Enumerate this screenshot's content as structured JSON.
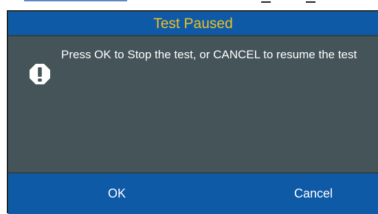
{
  "dialog": {
    "title": "Test Paused",
    "message": "Press OK to Stop the test, or CANCEL to resume the test",
    "icon": "exclamation-octagon-icon",
    "buttons": {
      "ok_label": "OK",
      "cancel_label": "Cancel"
    }
  },
  "colors": {
    "title_bar": "#0f5aa7",
    "title_text": "#f2c01e",
    "body_background": "#445459",
    "button_bar": "#0f5aa7",
    "text": "#ffffff"
  }
}
